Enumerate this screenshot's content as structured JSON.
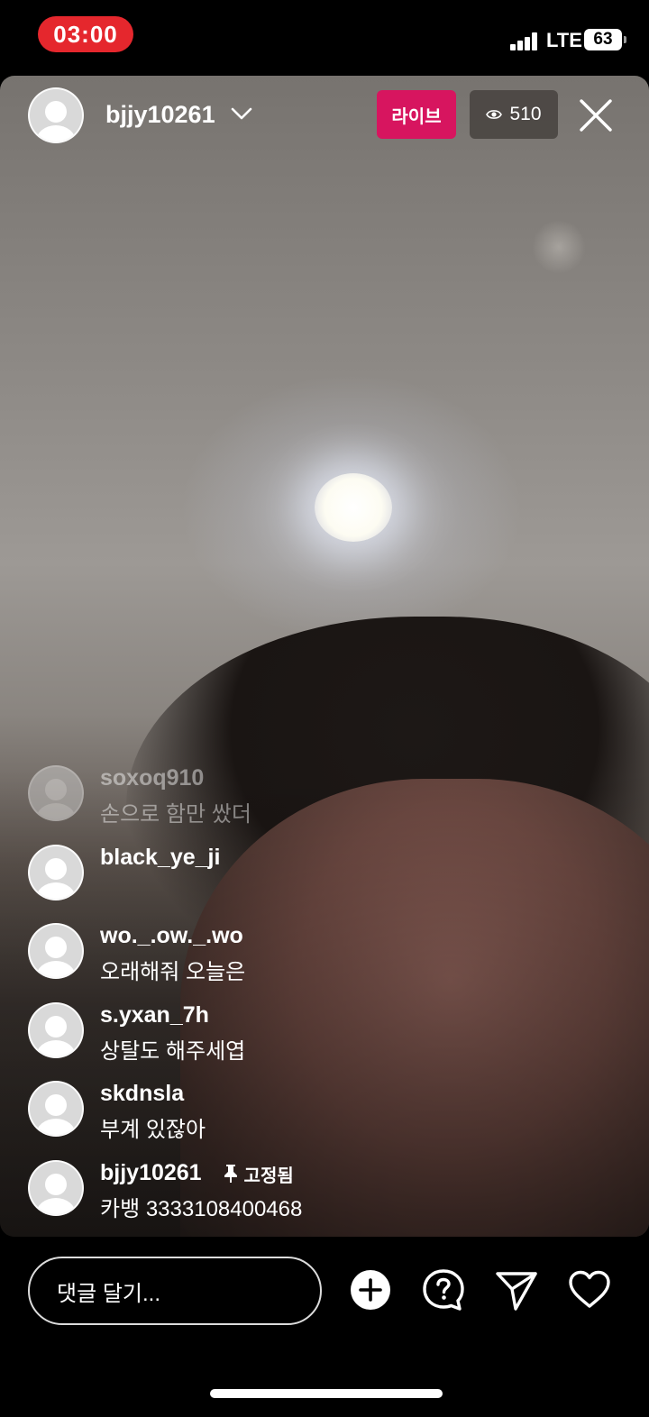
{
  "status_bar": {
    "time": "03:00",
    "network": "LTE",
    "battery": "63"
  },
  "header": {
    "username": "bjjy10261",
    "live_label": "라이브",
    "viewer_count": "510"
  },
  "comments": [
    {
      "user": "soxoq910",
      "text": "손으로 함만 쌌더",
      "faded": true
    },
    {
      "user": "black_ye_ji",
      "text": ""
    },
    {
      "user": "wo._.ow._.wo",
      "text": "오래해줘 오늘은"
    },
    {
      "user": "s.yxan_7h",
      "text": "상탈도 해주세엽"
    },
    {
      "user": "skdnsla",
      "text": "부계 있잖아"
    },
    {
      "user": "bjjy10261",
      "pinned_label": "고정됨",
      "text": "카뱅 3333108400468"
    }
  ],
  "bottom_bar": {
    "comment_placeholder": "댓글 달기..."
  },
  "colors": {
    "live_badge": "#d7155f",
    "time_pill": "#e5272d"
  },
  "icons": [
    "chevron-down-icon",
    "eye-icon",
    "close-icon",
    "pin-icon",
    "add-icon",
    "question-icon",
    "send-icon",
    "heart-icon"
  ]
}
